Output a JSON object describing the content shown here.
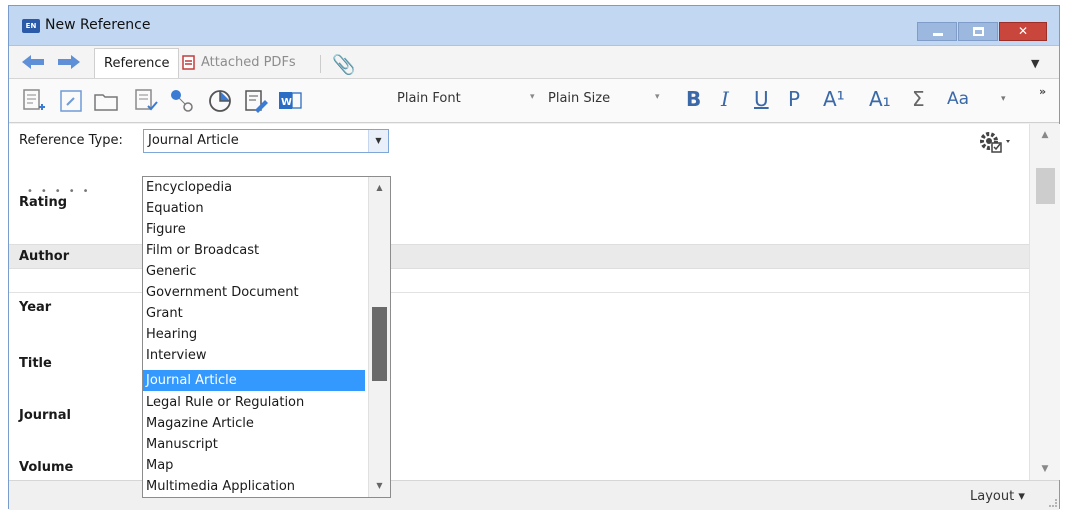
{
  "window": {
    "title": "New Reference",
    "app_icon_text": "EN"
  },
  "tabs": {
    "reference": "Reference",
    "attached_pdfs": "Attached PDFs"
  },
  "toolbar": {
    "font": "Plain Font",
    "size": "Plain Size",
    "bold": "B",
    "italic": "I",
    "underline": "U",
    "plain": "P",
    "superscript": "A¹",
    "subscript": "A₁",
    "symbol": "Σ",
    "case": "Aa",
    "more": "»",
    "dropdown_arrow": "▾"
  },
  "form": {
    "reference_type_label": "Reference Type:",
    "reference_type_value": "Journal Article",
    "fields": {
      "rating": "Rating",
      "rating_stars": "•••••",
      "author": "Author",
      "year": "Year",
      "title": "Title",
      "journal": "Journal",
      "volume": "Volume"
    }
  },
  "dropdown": {
    "items": [
      "Encyclopedia",
      "Equation",
      "Figure",
      "Film or Broadcast",
      "Generic",
      "Government Document",
      "Grant",
      "Hearing",
      "Interview",
      "Journal Article",
      "Legal Rule or Regulation",
      "Magazine Article",
      "Manuscript",
      "Map",
      "Multimedia Application"
    ],
    "selected_index": 9
  },
  "statusbar": {
    "layout": "Layout ▾"
  },
  "colors": {
    "selected": "#3399ff",
    "titlebar": "#c2d8f2",
    "close": "#c9463d",
    "format": "#3b69a8"
  }
}
